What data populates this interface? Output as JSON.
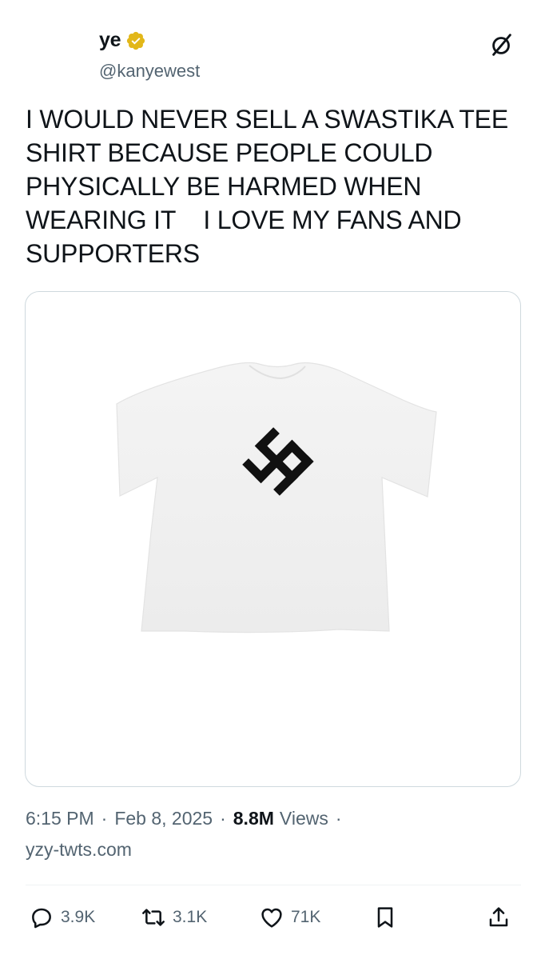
{
  "header": {
    "display_name": "ye",
    "handle": "@kanyewest",
    "verified_icon": "verified-badge-gold-icon",
    "grok_icon": "grok-icon"
  },
  "tweet": {
    "text": "I WOULD NEVER SELL A SWASTIKA TEE\nSHIRT BECAUSE PEOPLE COULD\nPHYSICALLY BE HARMED WHEN\nWEARING IT    I LOVE MY FANS AND\nSUPPORTERS"
  },
  "media": {
    "type": "photo",
    "subject": "tshirt-image"
  },
  "meta": {
    "time": "6:15 PM",
    "date": "Feb 8, 2025",
    "sep": "·",
    "views_count": "8.8M",
    "views_label": "Views",
    "source": "yzy-twts.com"
  },
  "actions": {
    "reply_count": "3.9K",
    "retweet_count": "3.1K",
    "like_count": "71K"
  },
  "colors": {
    "text": "#0f1419",
    "secondary": "#536471",
    "border": "#cfd9de",
    "verified_gold": "#e2b719"
  }
}
